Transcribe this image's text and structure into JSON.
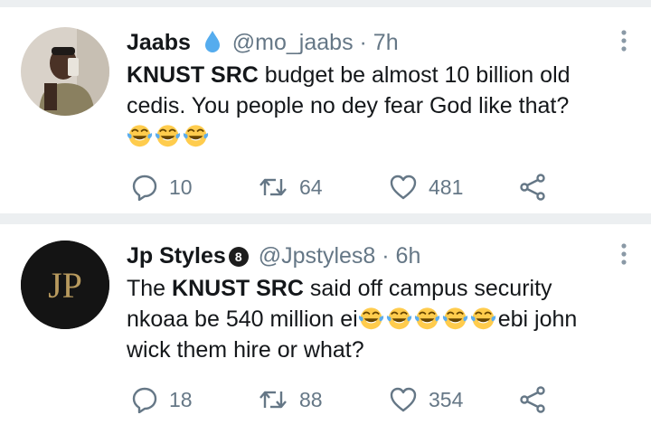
{
  "tweets": [
    {
      "name": "Jaabs",
      "name_badge_icon": "water-drop-icon",
      "handle": "@mo_jaabs",
      "time": "· 7h",
      "text_bold": "KNUST SRC",
      "text_1": " budget be almost 10 billion old",
      "text_2": "cedis. You people no dey fear God like that?",
      "emoji_count_line3": 3,
      "replies": "10",
      "retweets": "64",
      "likes": "481"
    },
    {
      "name": "Jp Styles",
      "name_badge_icon": "eight-ball-icon",
      "name_badge_text": "8",
      "handle": "@Jpstyles8",
      "time": "· 6h",
      "avatar_text": "JP",
      "text_prefix": "The ",
      "text_bold": "KNUST SRC",
      "text_1": " said off campus security",
      "text_2a": "nkoaa be 540 million ei",
      "text_2b": "ebi john",
      "text_3": "wick them hire or what?",
      "replies": "18",
      "retweets": "88",
      "likes": "354"
    }
  ],
  "colors": {
    "secondary": "#657786",
    "separator": "#eceff1",
    "drop": "#55acee"
  }
}
